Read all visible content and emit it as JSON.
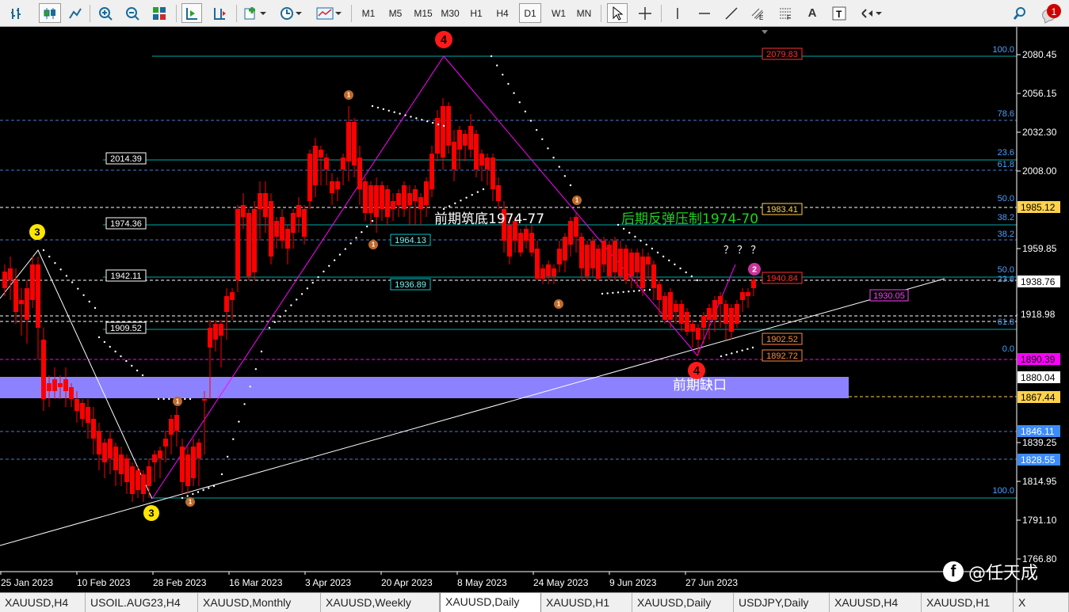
{
  "toolbar": {
    "timeframes": [
      "M1",
      "M5",
      "M15",
      "M30",
      "H1",
      "H4",
      "D1",
      "W1",
      "MN"
    ],
    "active_timeframe": "D1",
    "notification_count": "1"
  },
  "chart": {
    "price_ticks": [
      "2080.45",
      "2056.15",
      "2032.30",
      "2008.00",
      "1959.85",
      "1918.98",
      "1839.25",
      "1814.95",
      "1791.10",
      "1766.80"
    ],
    "date_ticks": [
      "25 Jan 2023",
      "10 Feb 2023",
      "28 Feb 2023",
      "16 Mar 2023",
      "3 Apr 2023",
      "20 Apr 2023",
      "8 May 2023",
      "24 May 2023",
      "9 Jun 2023",
      "27 Jun 2023"
    ],
    "price_badges": {
      "current": "1938.76",
      "p1985": "1985.12",
      "p1890": "1890.39",
      "p1880": "1880.04",
      "p1867": "1867.44",
      "p1846": "1846.11",
      "p1828": "1828.55"
    },
    "level_labels": {
      "l2014": "2014.39",
      "l1974": "1974.36",
      "l1942": "1942.11",
      "l1909": "1909.52",
      "l1964": "1964.13",
      "l1936": "1936.89"
    },
    "in_chart_labels": {
      "top_high": "2079.83",
      "r1983": "1983.41",
      "r1940": "1940.84",
      "r1930": "1930.05",
      "r1902": "1902.52",
      "r1892": "1892.72"
    },
    "fib_labels": [
      "100.0",
      "78.6",
      "23.6",
      "61.8",
      "50.0",
      "38.2",
      "38.2",
      "50.0",
      "23.6",
      "61.8",
      "0.0",
      "100.0"
    ],
    "annotations": {
      "support_text": "前期筑底1974-77",
      "resistance_text": "后期反弹压制1974-70",
      "gap_text": "前期缺口",
      "question_marks": "？ ？ ？"
    },
    "wave_labels": {
      "big4_top": "4",
      "big4_bottom": "4",
      "y3_left": "3",
      "y3_bottom": "3",
      "pink2": "2",
      "small1": "1"
    }
  },
  "tabs": [
    "XAUUSD,H4",
    "USOIL.AUG23,H4",
    "XAUUSD,Monthly",
    "XAUUSD,Weekly",
    "XAUUSD,Daily",
    "XAUUSD,H1",
    "XAUUSD,Daily",
    "USDJPY,Daily",
    "XAUUSD,H4",
    "XAUUSD,H1",
    "X"
  ],
  "active_tab_index": 4,
  "watermark": {
    "icon": "f",
    "text": "@任天成"
  },
  "colors": {
    "bull": "#00ff00",
    "bear": "#ff0000",
    "gap_zone": "#8c82ff",
    "fib_line": "#00c8c8",
    "zigzag": "#ff00ff"
  }
}
